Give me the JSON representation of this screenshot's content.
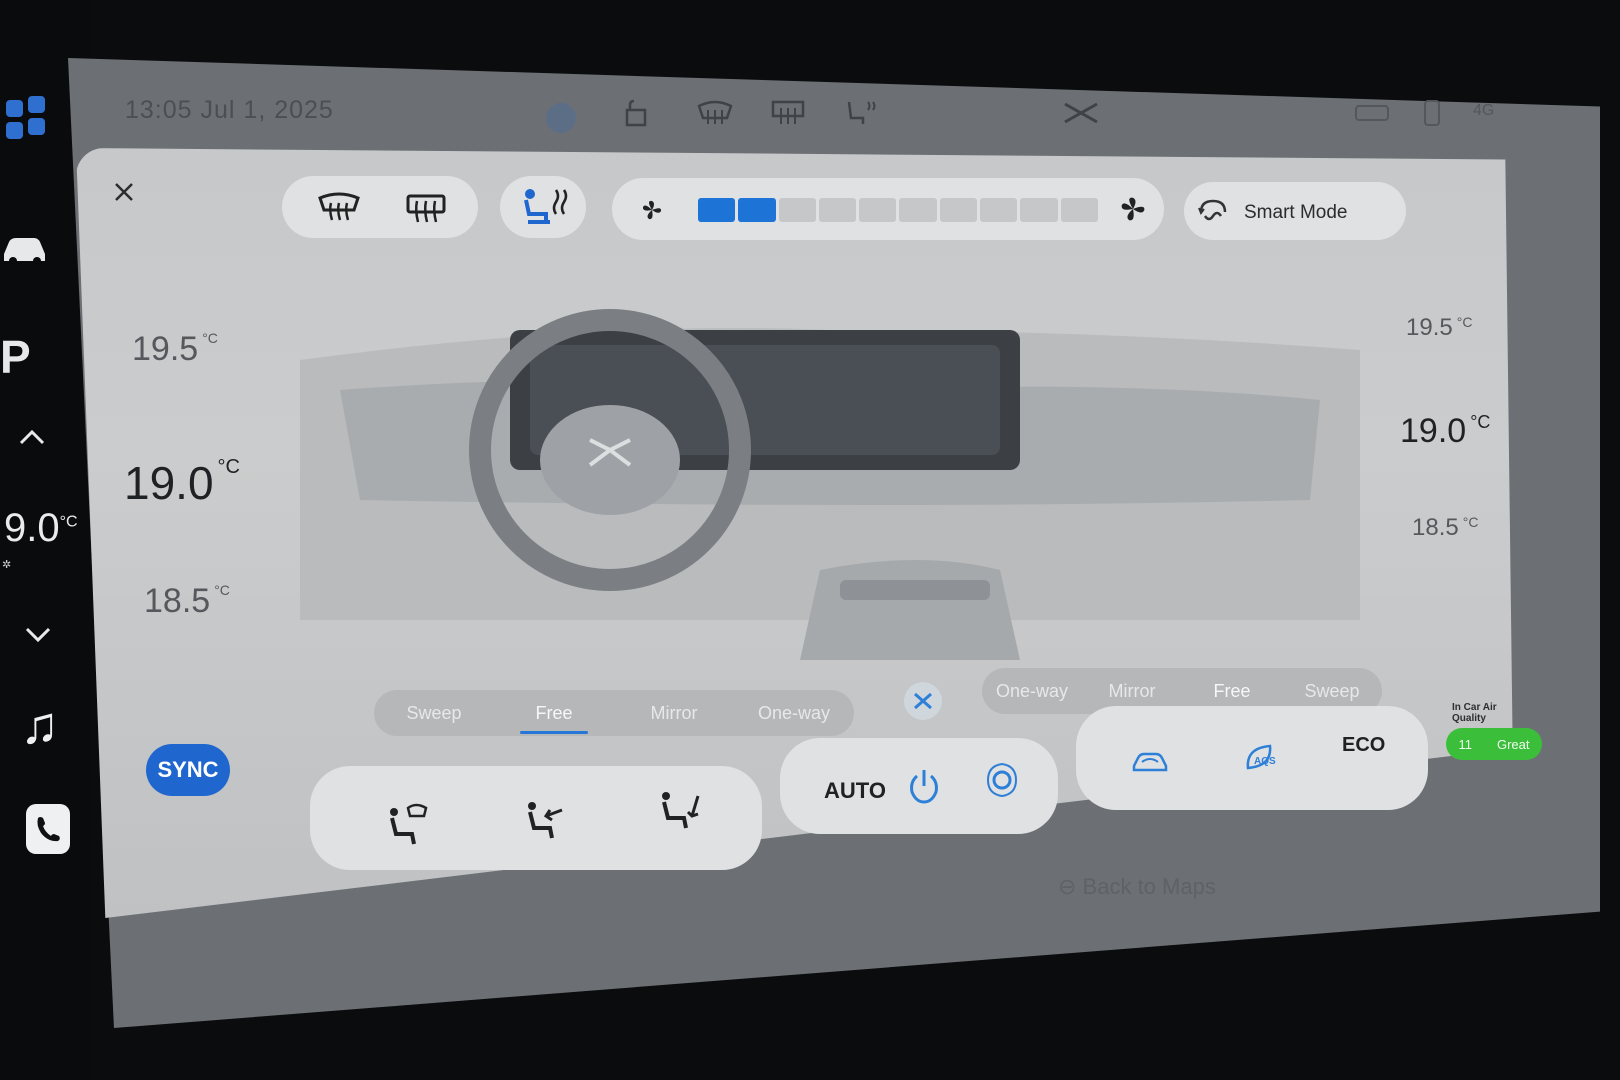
{
  "status_bar": {
    "time_date": "13:05  Jul 1, 2025",
    "signal": "4G"
  },
  "dock": {
    "cabin_temp": "9.0",
    "cabin_temp_unit": "°C",
    "park_label": "P"
  },
  "climate": {
    "smart_mode_label": "Smart Mode",
    "fan_speed_level": 2,
    "fan_speed_max": 10,
    "left_temps": {
      "above": "19.5",
      "current": "19.0",
      "below": "18.5",
      "unit": "°C"
    },
    "right_temps": {
      "above": "19.5",
      "current": "19.0",
      "below": "18.5",
      "unit": "°C"
    },
    "left_vent_modes": [
      "Sweep",
      "Free",
      "Mirror",
      "One-way"
    ],
    "left_vent_active": "Free",
    "right_vent_modes": [
      "One-way",
      "Mirror",
      "Free",
      "Sweep"
    ],
    "right_vent_active": "Free",
    "sync_label": "SYNC",
    "auto_label": "AUTO",
    "eco_label": "ECO",
    "aqs_label": "AQS",
    "air_quality_title": "In Car Air Quality",
    "air_quality_value": "11",
    "air_quality_status": "Great",
    "back_to_maps": "Back to Maps",
    "accent_color": "#1f66cf"
  }
}
